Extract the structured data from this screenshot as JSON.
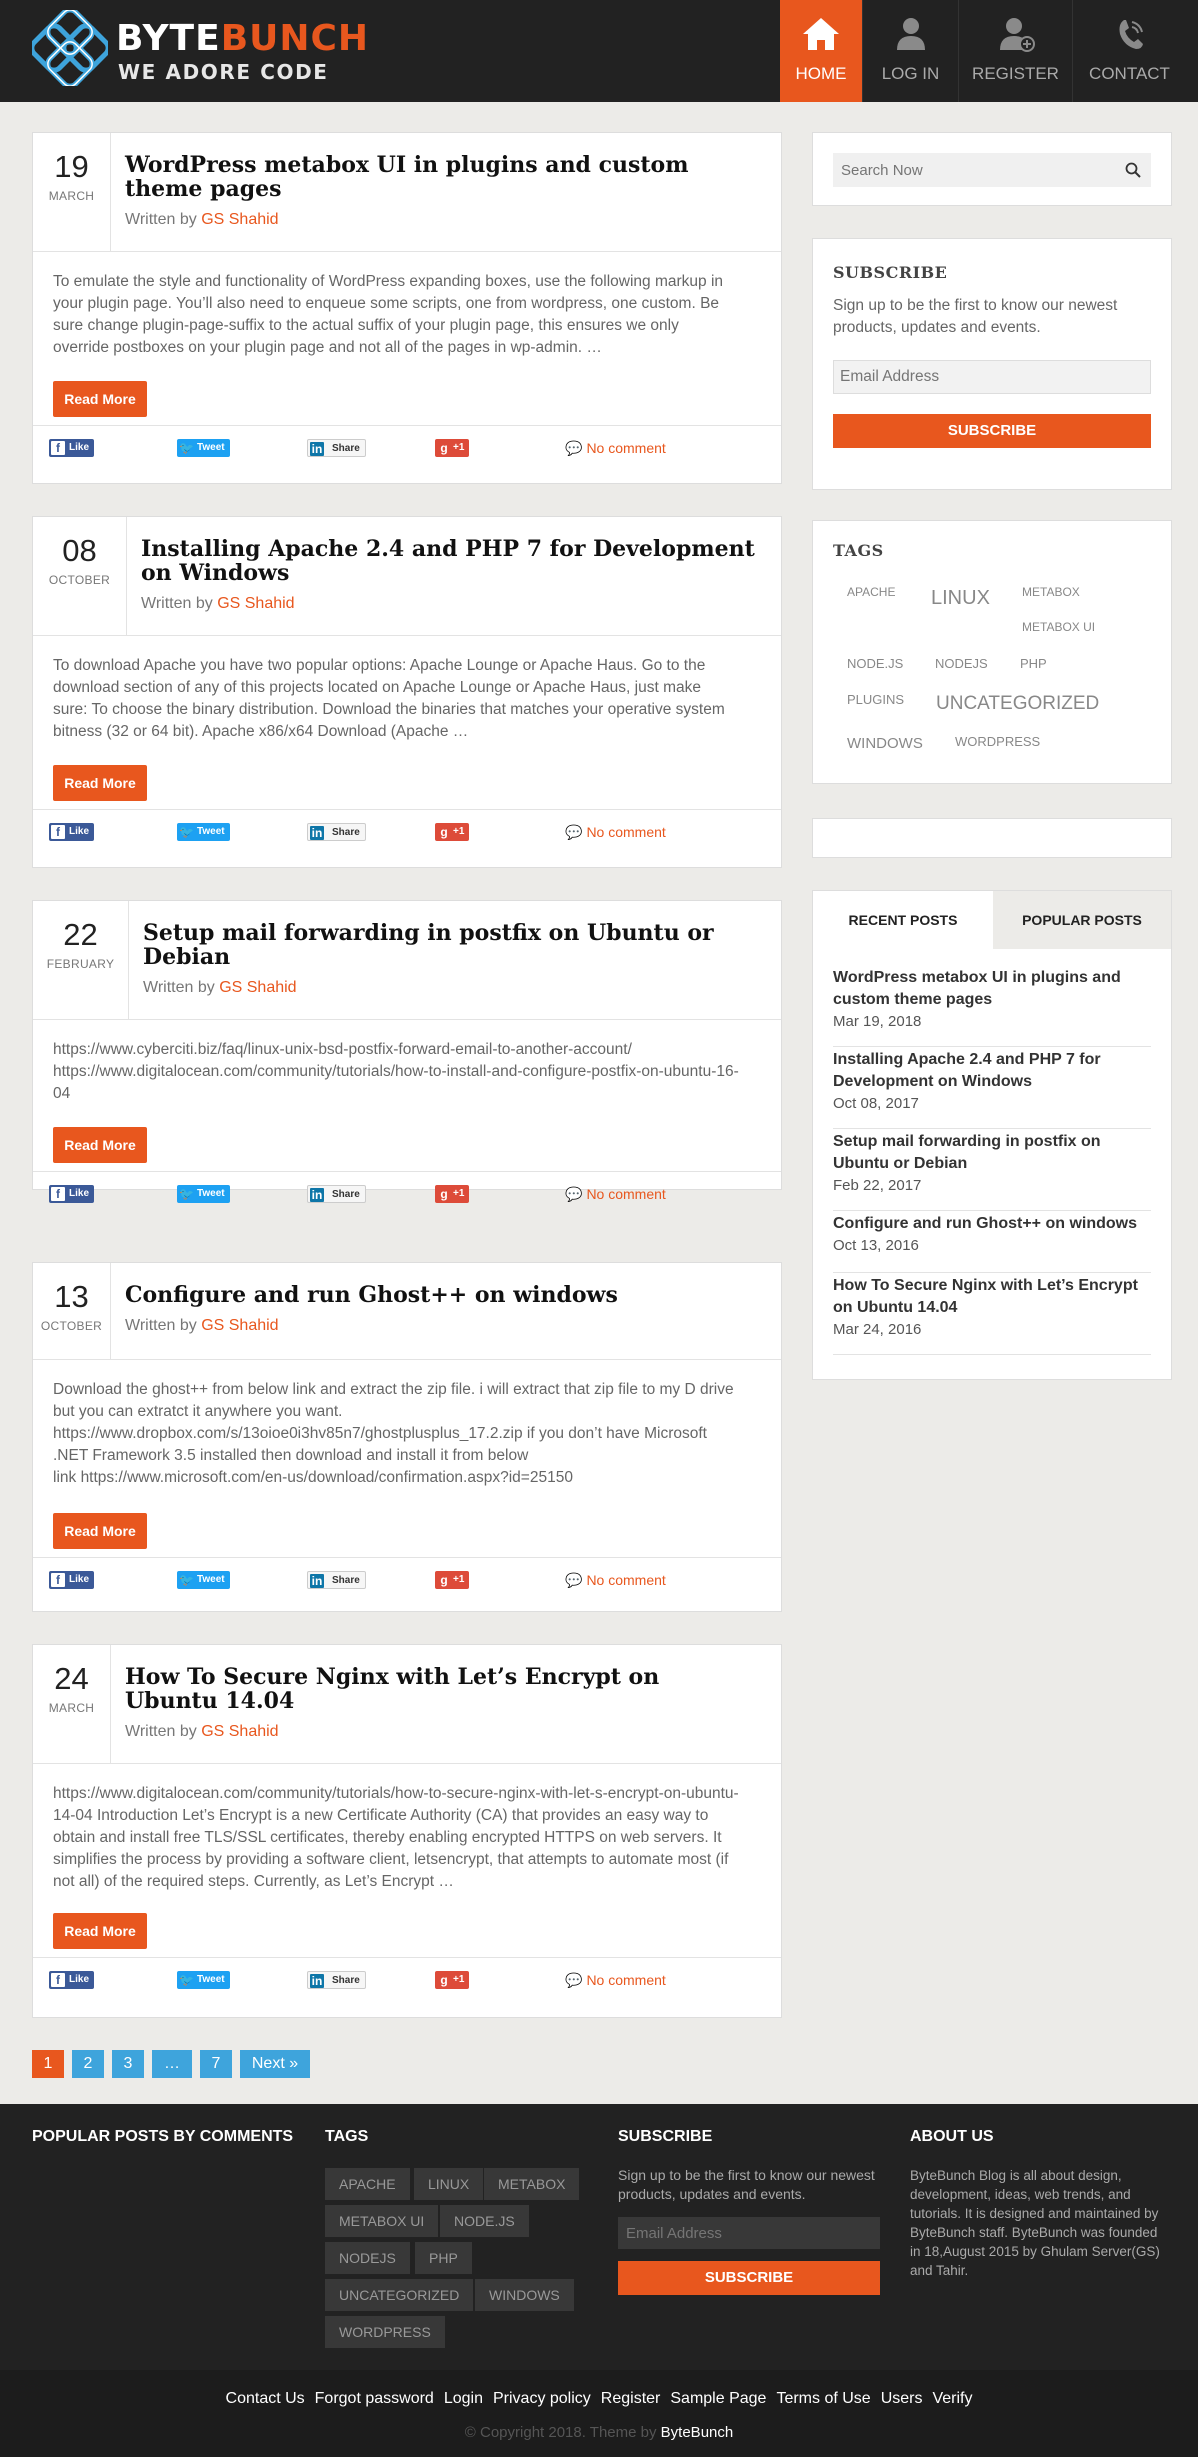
{
  "brand": {
    "name_part1": "BYTE",
    "name_part2": "BUNCH",
    "tagline": "WE ADORE CODE"
  },
  "nav": [
    {
      "label": "HOME",
      "icon": "home-icon",
      "active": true
    },
    {
      "label": "LOG IN",
      "icon": "user-icon"
    },
    {
      "label": "REGISTER",
      "icon": "user-add-icon"
    },
    {
      "label": "CONTACT",
      "icon": "phone-icon"
    }
  ],
  "colors": {
    "accent": "#e8571e",
    "link_blue": "#3ea4dc",
    "header_bg": "#222222",
    "page_bg": "#ecebe8"
  },
  "posts": [
    {
      "day": "19",
      "month": "MARCH",
      "title_l1": "WordPress metabox UI in plugins and custom",
      "title_l2": "theme pages",
      "written_by": "Written by",
      "author": "GS Shahid",
      "excerpt": [
        "To emulate the style and functionality of WordPress expanding boxes, use the following markup in",
        "your plugin page. You’ll also need to enqueue some scripts, one from wordpress, one custom. Be",
        "sure change plugin-page-suffix to the actual suffix of your plugin page, this ensures we only",
        "override postboxes on your plugin page and not all of the pages in wp-admin. …"
      ],
      "read_more": "Read More",
      "comments": "No comment"
    },
    {
      "day": "08",
      "month": "OCTOBER",
      "title_l1": "Installing Apache 2.4 and PHP 7 for Development",
      "title_l2": "on Windows",
      "written_by": "Written by",
      "author": "GS Shahid",
      "excerpt": [
        "To download Apache you have two popular options: Apache Lounge or Apache Haus. Go to the",
        "download section of any of this projects located on Apache Lounge or Apache Haus, just make",
        "sure: To choose the binary distribution. Download the binaries that matches your operative system",
        "bitness (32 or 64 bit). Apache x86/x64 Download (Apache …"
      ],
      "read_more": "Read More",
      "comments": "No comment"
    },
    {
      "day": "22",
      "month": "FEBRUARY",
      "title_l1": "Setup mail forwarding in postfix on Ubuntu or",
      "title_l2": "Debian",
      "written_by": "Written by",
      "author": "GS Shahid",
      "excerpt": [
        "https://www.cyberciti.biz/faq/linux-unix-bsd-postfix-forward-email-to-another-account/",
        "https://www.digitalocean.com/community/tutorials/how-to-install-and-configure-postfix-on-ubuntu-16-",
        "04"
      ],
      "read_more": "Read More",
      "comments": "No comment"
    },
    {
      "day": "13",
      "month": "OCTOBER",
      "title_l1": "Configure and run Ghost++ on windows",
      "title_l2": "",
      "written_by": "Written by",
      "author": "GS Shahid",
      "excerpt": [
        "Download the ghost++ from below link and extract the zip file. i will extract that zip file to my D drive",
        "but you can extratct it anywhere you want.",
        "https://www.dropbox.com/s/13oioe0i3hv85n7/ghostplusplus_17.2.zip if you don’t have Microsoft",
        ".NET Framework 3.5 installed then download and install it from below",
        "link https://www.microsoft.com/en-us/download/confirmation.aspx?id=25150"
      ],
      "read_more": "Read More",
      "comments": "No comment"
    },
    {
      "day": "24",
      "month": "MARCH",
      "title_l1": "How To Secure Nginx with Let’s Encrypt on",
      "title_l2": "Ubuntu 14.04",
      "written_by": "Written by",
      "author": "GS Shahid",
      "excerpt": [
        "https://www.digitalocean.com/community/tutorials/how-to-secure-nginx-with-let-s-encrypt-on-ubuntu-",
        "14-04 Introduction Let’s Encrypt is a new Certificate Authority (CA) that provides an easy way to",
        "obtain and install free TLS/SSL certificates, thereby enabling encrypted HTTPS on web servers. It",
        "simplifies the process by providing a software client, letsencrypt, that attempts to automate most (if",
        "not all) of the required steps. Currently, as Let’s Encrypt …"
      ],
      "read_more": "Read More",
      "comments": "No comment"
    }
  ],
  "share": {
    "like": "Like",
    "tweet": "Tweet",
    "share": "Share",
    "plusone": "+1"
  },
  "search": {
    "placeholder": "Search Now"
  },
  "subscribe": {
    "title": "SUBSCRIBE",
    "text_l1": "Sign up to be the first to know our newest",
    "text_l2": "products, updates and events.",
    "email_placeholder": "Email Address",
    "button": "SUBSCRIBE"
  },
  "tags_widget": {
    "title": "TAGS",
    "tags": [
      "apache",
      "linux",
      "metabox",
      "metabox ui",
      "node.js",
      "nodejs",
      "php",
      "plugins",
      "Uncategorized",
      "windows",
      "wordpress"
    ]
  },
  "tabs": {
    "recent": "RECENT POSTS",
    "popular": "POPULAR POSTS"
  },
  "recent_posts": [
    {
      "title_l1": "WordPress metabox UI in plugins and",
      "title_l2": "custom theme pages",
      "date": "Mar 19, 2018"
    },
    {
      "title_l1": "Installing Apache 2.4 and PHP 7 for",
      "title_l2": "Development on Windows",
      "date": "Oct 08, 2017"
    },
    {
      "title_l1": "Setup mail forwarding in postfix on",
      "title_l2": "Ubuntu or Debian",
      "date": "Feb 22, 2017"
    },
    {
      "title_l1": "Configure and run Ghost++ on windows",
      "title_l2": "",
      "date": "Oct 13, 2016"
    },
    {
      "title_l1": "How To Secure Nginx with Let’s Encrypt",
      "title_l2": "on Ubuntu 14.04",
      "date": "Mar 24, 2016"
    }
  ],
  "pagination": {
    "pages": [
      "1",
      "2",
      "3",
      "…",
      "7"
    ],
    "current_page": "1",
    "next": "Next »"
  },
  "footer": {
    "popular_title": "POPULAR POSTS BY COMMENTS",
    "tags_title": "TAGS",
    "tags": [
      "apache",
      "linux",
      "metabox",
      "metabox ui",
      "node.js",
      "nodejs",
      "php",
      "Uncategorized",
      "windows",
      "wordpress"
    ],
    "subscribe_title": "SUBSCRIBE",
    "subscribe_text_l1": "Sign up to be the first to know our newest",
    "subscribe_text_l2": "products, updates and events.",
    "email_placeholder": "Email Address",
    "subscribe_button": "SUBSCRIBE",
    "about_title": "ABOUT US",
    "about_lines": [
      "ByteBunch Blog is all about design,",
      "development, ideas, web trends, and",
      "tutorials. It is designed and maintained by",
      "ByteBunch staff. ByteBunch was founded",
      "in 18,August 2015 by Ghulam Server(GS)",
      "and Tahir."
    ]
  },
  "bottom_links": [
    "Contact Us",
    "Forgot password",
    "Login",
    "Privacy policy",
    "Register",
    "Sample Page",
    "Terms of Use",
    "Users",
    "Verify"
  ],
  "copyright": {
    "text": "© Copyright 2018. Theme by",
    "brand": "ByteBunch"
  }
}
